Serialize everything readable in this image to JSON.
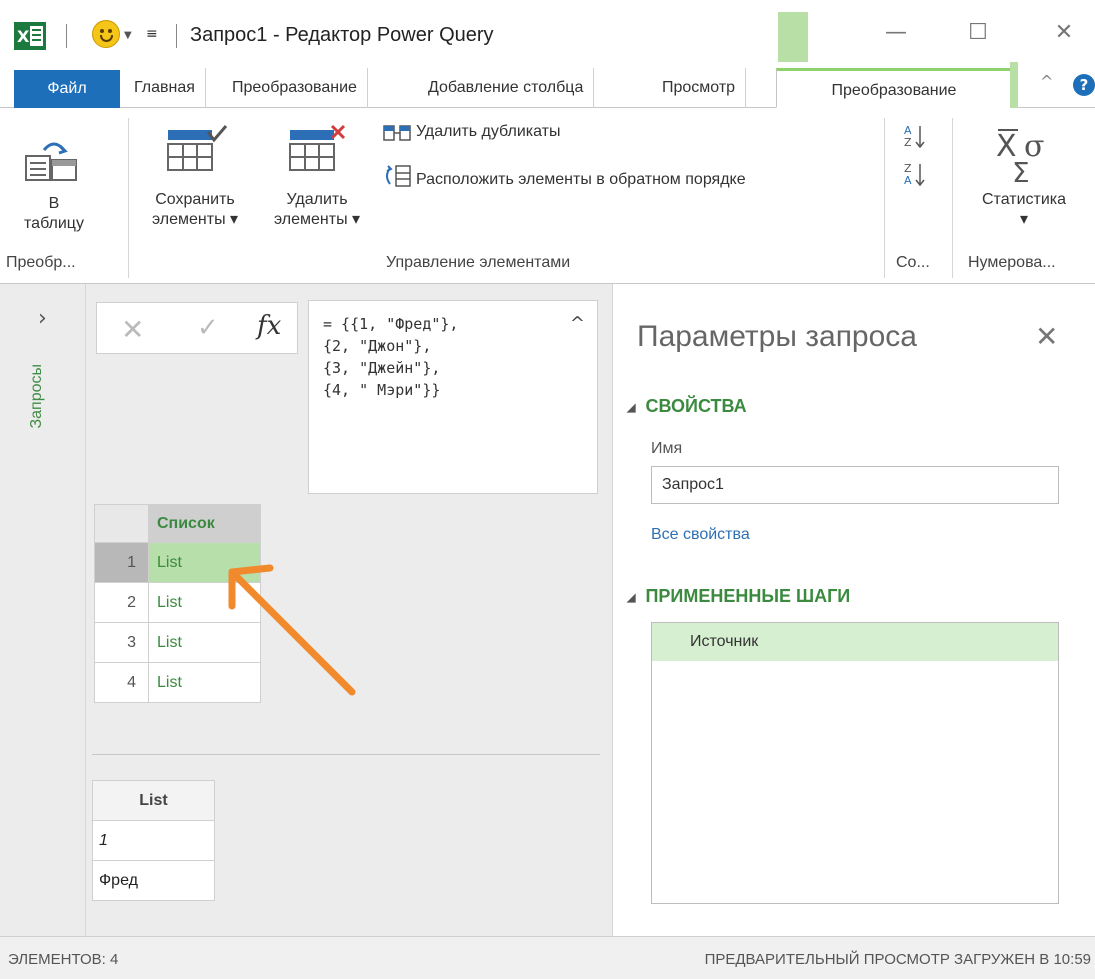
{
  "window": {
    "title": "Запрос1 - Редактор Power Query",
    "minimize": "—",
    "maximize": "☐",
    "close": "✕"
  },
  "tabs": [
    {
      "label": "Файл"
    },
    {
      "label": "Главная"
    },
    {
      "label": "Преобразование"
    },
    {
      "label": "Добавление столбца"
    },
    {
      "label": "Просмотр"
    },
    {
      "label": "Преобразование"
    }
  ],
  "ribbon": {
    "to_table": "В\nтаблицу",
    "keep_rows": "Сохранить\nэлементы ▾",
    "remove_rows": "Удалить\nэлементы ▾",
    "remove_duplicates": "Удалить дубликаты",
    "reverse_items": "Расположить элементы в обратном порядке",
    "statistics": "Статистика\n▾",
    "groups": {
      "convert": "Преобр...",
      "manage": "Управление элементами",
      "sort": "Со...",
      "numeric": "Нумерова..."
    }
  },
  "nav": {
    "queries": "Запросы"
  },
  "formula": "= {{1, \"Фред\"},\n{2, \"Джон\"},\n{3, \"Джейн\"},\n{4, \" Мэри\"}}",
  "grid": {
    "header": "Список",
    "rows": [
      {
        "num": "1",
        "value": "List"
      },
      {
        "num": "2",
        "value": "List"
      },
      {
        "num": "3",
        "value": "List"
      },
      {
        "num": "4",
        "value": "List"
      }
    ]
  },
  "preview": {
    "header": "List",
    "rows": [
      "1",
      "Фред"
    ]
  },
  "query_settings": {
    "title": "Параметры запроса",
    "properties_header": "СВОЙСТВА",
    "name_label": "Имя",
    "name_value": "Запрос1",
    "all_properties": "Все свойства",
    "applied_steps_header": "ПРИМЕНЕННЫЕ ШАГИ",
    "steps": [
      "Источник"
    ]
  },
  "status": {
    "left": "ЭЛЕМЕНТОВ: 4",
    "right": "ПРЕДВАРИТЕЛЬНЫЙ ПРОСМОТР ЗАГРУЖЕН В 10:59"
  },
  "colors": {
    "accent_blue": "#1e6fba",
    "accent_green": "#3b8a3f",
    "arrow_orange": "#f08a2c"
  }
}
